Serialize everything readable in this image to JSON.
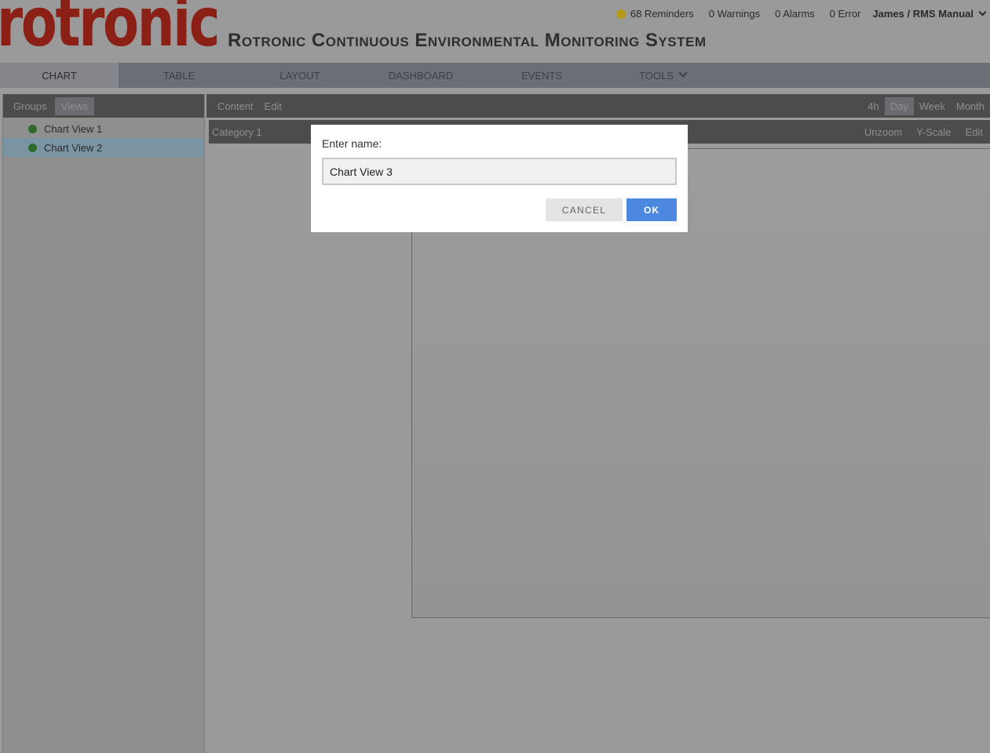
{
  "header": {
    "logo_text": "rotronic",
    "title": "Rotronic Continuous Environmental Monitoring System",
    "status": {
      "reminders": "68 Reminders",
      "warnings": "0 Warnings",
      "alarms": "0 Alarms",
      "errors": "0 Error",
      "user": "James / RMS Manual"
    }
  },
  "nav": {
    "tabs": [
      {
        "label": "CHART",
        "active": true
      },
      {
        "label": "TABLE"
      },
      {
        "label": "LAYOUT"
      },
      {
        "label": "DASHBOARD"
      },
      {
        "label": "EVENTS"
      },
      {
        "label": "TOOLS"
      }
    ]
  },
  "left_panel": {
    "tabs": [
      {
        "label": "Groups"
      },
      {
        "label": "Views",
        "active": true
      }
    ],
    "views": [
      {
        "label": "Chart View 1"
      },
      {
        "label": "Chart View 2",
        "selected": true
      }
    ]
  },
  "toolbar": {
    "left": [
      "Content",
      "Edit"
    ],
    "ranges": [
      "4h",
      "Day",
      "Week",
      "Month"
    ],
    "active_range": "Day"
  },
  "category_bar": {
    "label": "Category 1",
    "actions": [
      "Unzoom",
      "Y-Scale",
      "Edit"
    ]
  },
  "dialog": {
    "prompt": "Enter name:",
    "value": "Chart View 3",
    "cancel_label": "CANCEL",
    "ok_label": "OK"
  },
  "colors": {
    "logo": "#8a2016",
    "ok_button": "#4c88e0",
    "status_dot": "#b49a17",
    "view_dot": "#2f6b28"
  }
}
